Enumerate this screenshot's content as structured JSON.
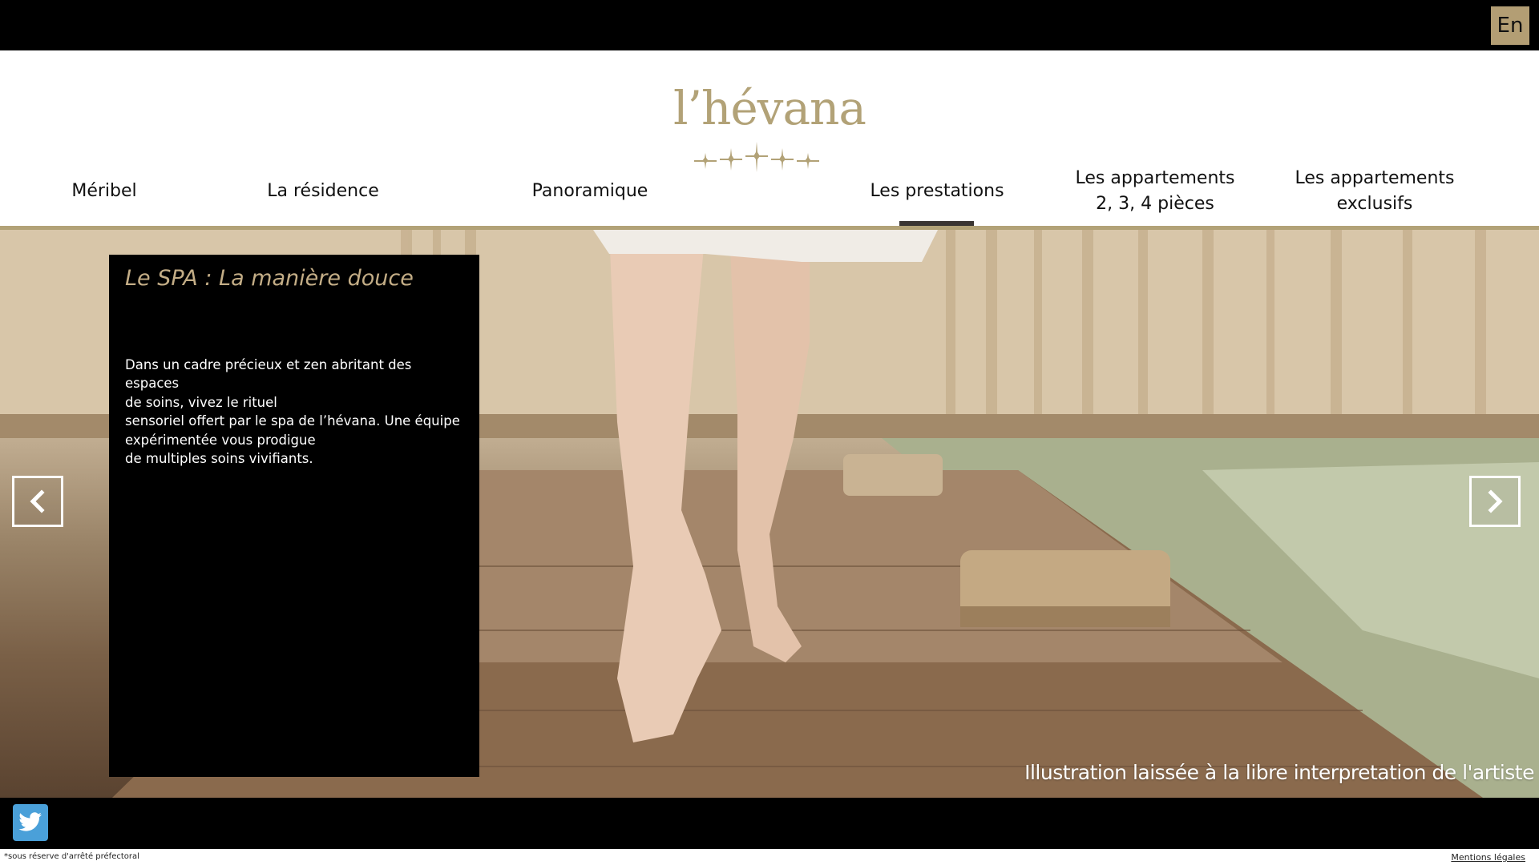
{
  "lang_switch": {
    "label": "En"
  },
  "logo": {
    "text": "l’hévana",
    "stars_icon": "five-stars-icon"
  },
  "nav": {
    "items": [
      {
        "label": "Méribel"
      },
      {
        "label": "La résidence"
      },
      {
        "label": "Panoramique"
      },
      {
        "label": "Les prestations",
        "active": true
      },
      {
        "label_lines": [
          "Les appartements",
          "2, 3, 4 pièces"
        ]
      },
      {
        "label_lines": [
          "Les appartements",
          "exclusifs"
        ]
      }
    ]
  },
  "panel": {
    "title": "Le SPA : La manière douce",
    "body_lines": [
      "Dans un cadre précieux et zen abritant des espaces",
      "de soins, vivez le rituel",
      "sensoriel offert par le spa de l’hévana. Une équipe",
      "expérimentée vous prodigue",
      "de multiples soins vivifiants."
    ]
  },
  "carousel": {
    "prev_icon": "chevron-left-icon",
    "next_icon": "chevron-right-icon"
  },
  "caption": "Illustration laissée à la libre interpretation de l'artiste",
  "footer": {
    "social_icon": "twitter-icon",
    "note": "*sous réserve d'arrêté préfectoral",
    "legal_link": "Mentions légales"
  },
  "colors": {
    "gold": "#b2a277",
    "black": "#000000",
    "twitter": "#4aa0d9"
  }
}
